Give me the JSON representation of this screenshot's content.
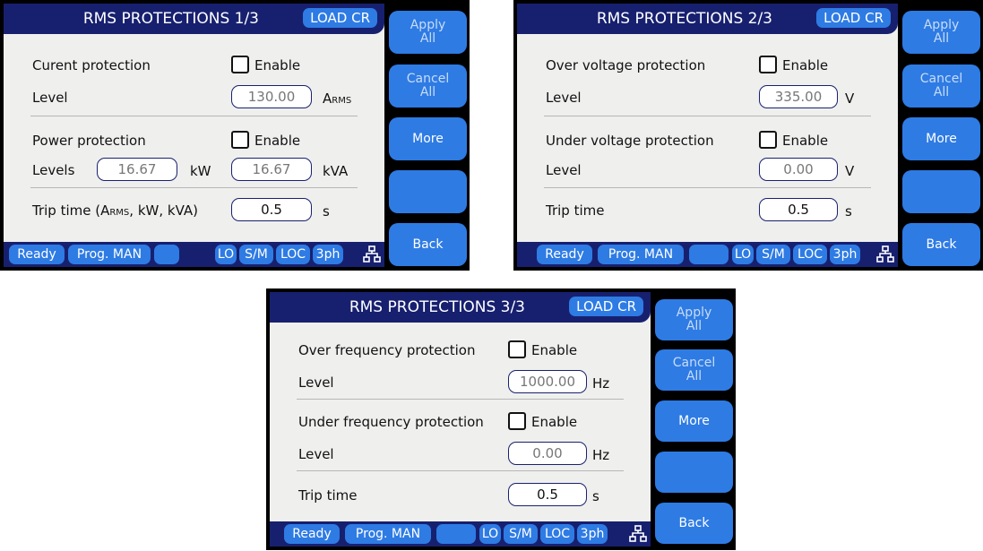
{
  "status_bar": {
    "ready": "Ready",
    "prog": "Prog. MAN",
    "lo": "LO",
    "sm": "S/M",
    "loc": "LOC",
    "phase": "3ph",
    "network_icon": "network-icon"
  },
  "side_buttons": {
    "apply_1": "Apply",
    "apply_2": "All",
    "cancel_1": "Cancel",
    "cancel_2": "All",
    "more": "More",
    "back": "Back"
  },
  "enable_label": "Enable",
  "screens": [
    {
      "title": "RMS PROTECTIONS 1/3",
      "mode": "LOAD CR",
      "sec1_label": "Curent protection",
      "level_label": "Level",
      "level_value": "130.00",
      "level_unit": "A",
      "level_unit_sub": "RMS",
      "sec2_label": "Power protection",
      "levels_label": "Levels",
      "kw_value": "16.67",
      "kw_unit": "kW",
      "kva_value": "16.67",
      "kva_unit": "kVA",
      "trip_label": "Trip time (A",
      "trip_label_sub": "RMS",
      "trip_label_end": ", kW, kVA)",
      "trip_value": "0.5",
      "trip_unit": "s"
    },
    {
      "title": "RMS PROTECTIONS 2/3",
      "mode": "LOAD CR",
      "sec1_label": "Over voltage protection",
      "level1_label": "Level",
      "level1_value": "335.00",
      "level1_unit": "V",
      "sec2_label": "Under voltage protection",
      "level2_label": "Level",
      "level2_value": "0.00",
      "level2_unit": "V",
      "trip_label": "Trip time",
      "trip_value": "0.5",
      "trip_unit": "s"
    },
    {
      "title": "RMS PROTECTIONS 3/3",
      "mode": "LOAD CR",
      "sec1_label": "Over frequency protection",
      "level1_label": "Level",
      "level1_value": "1000.00",
      "level1_unit": "Hz",
      "sec2_label": "Under frequency protection",
      "level2_label": "Level",
      "level2_value": "0.00",
      "level2_unit": "Hz",
      "trip_label": "Trip time",
      "trip_value": "0.5",
      "trip_unit": "s"
    }
  ]
}
